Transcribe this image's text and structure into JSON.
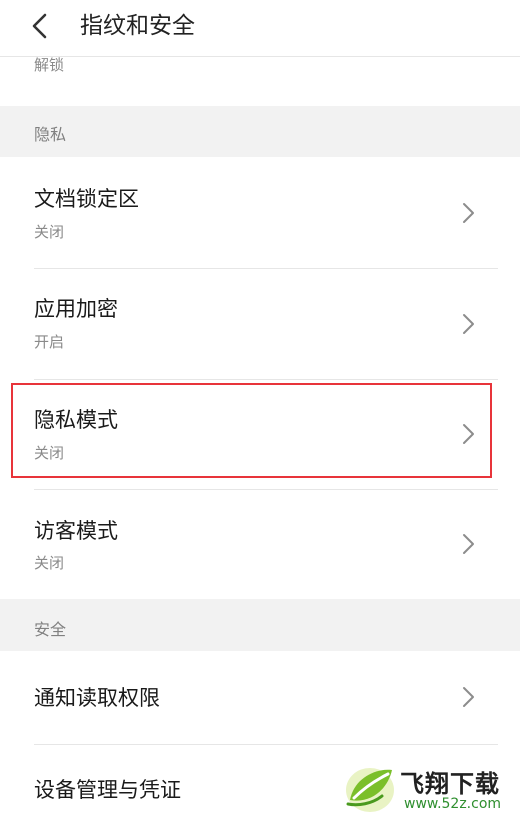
{
  "header": {
    "title": "指纹和安全"
  },
  "prev_item": {
    "subtitle": "解锁"
  },
  "sections": [
    {
      "label": "隐私",
      "items": [
        {
          "title": "文档锁定区",
          "status": "关闭"
        },
        {
          "title": "应用加密",
          "status": "开启"
        },
        {
          "title": "隐私模式",
          "status": "关闭"
        },
        {
          "title": "访客模式",
          "status": "关闭"
        }
      ]
    },
    {
      "label": "安全",
      "items": [
        {
          "title": "通知读取权限"
        },
        {
          "title": "设备管理与凭证"
        }
      ]
    }
  ],
  "colors": {
    "highlight": "#e8343a",
    "section_bg": "#f2f2f2",
    "subtitle": "#8a8a8a"
  },
  "watermark": {
    "text": "飞翔下载",
    "url": "www.52z.com",
    "logo_icon": "green-leaf-logo"
  }
}
